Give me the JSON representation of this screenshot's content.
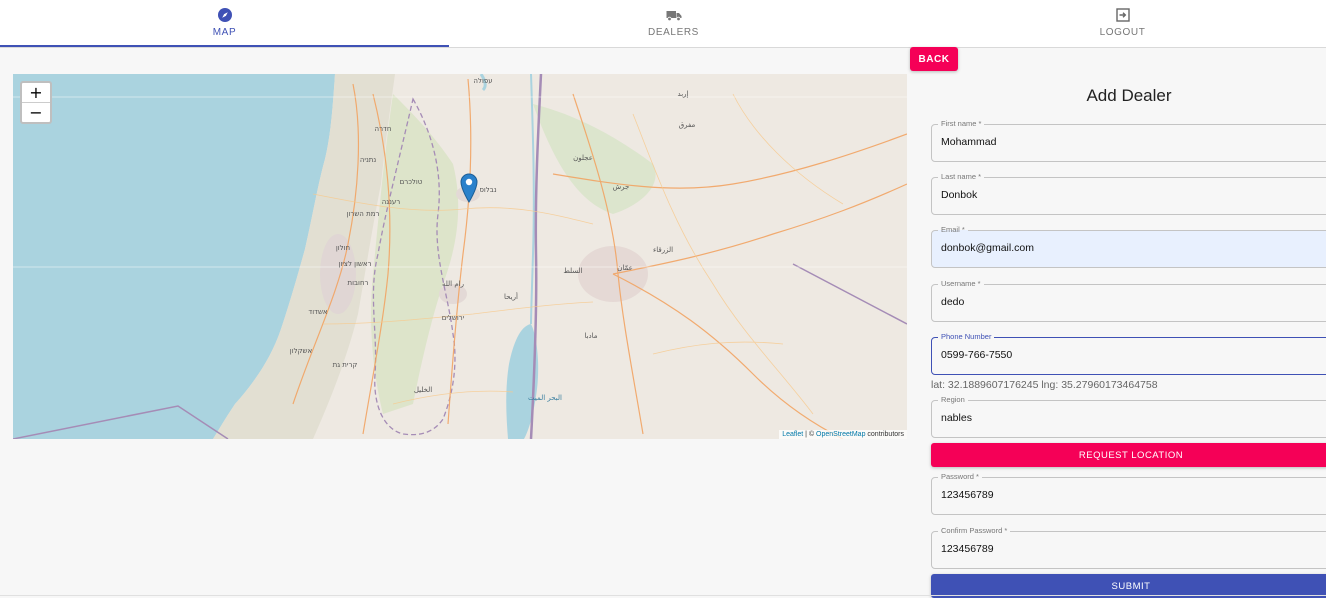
{
  "tabs": [
    {
      "label": "MAP",
      "icon": "compass-icon",
      "active": true
    },
    {
      "label": "DEALERS",
      "icon": "truck-icon",
      "active": false
    },
    {
      "label": "LOGOUT",
      "icon": "logout-icon",
      "active": false
    }
  ],
  "back_label": "BACK",
  "map": {
    "zoom_in": "+",
    "zoom_out": "−",
    "attribution": {
      "leaflet": "Leaflet",
      "sep": " | © ",
      "osm": "OpenStreetMap",
      "suffix": " contributors"
    },
    "place_labels": [
      "עפולה",
      "נתניה",
      "חדרה",
      "נבלוס",
      "טולכרם",
      "רמת השרון",
      "רעננה",
      "חולון",
      "ראשון לציון",
      "רחובות",
      "אשדוד",
      "אשקלון",
      "קרית גת",
      "ירושלים",
      "رام الله",
      "أريحا",
      "الخليل",
      "عمّان",
      "الزرقاء",
      "السلط",
      "جرش",
      "عجلون",
      "إربد",
      "مادبا",
      "مفرق",
      "البحر الميت"
    ]
  },
  "form": {
    "title": "Add Dealer",
    "fields": [
      {
        "label": "First name *",
        "value": "Mohammad"
      },
      {
        "label": "Last name *",
        "value": "Donbok"
      },
      {
        "label": "Email *",
        "value": "donbok@gmail.com"
      },
      {
        "label": "Username *",
        "value": "dedo"
      },
      {
        "label": "Phone Number",
        "value": "0599-766-7550"
      },
      {
        "label": "Region",
        "value": "nables"
      },
      {
        "label": "Password *",
        "value": "123456789"
      },
      {
        "label": "Confirm Password *",
        "value": "123456789"
      }
    ],
    "coords": "lat: 32.1889607176245 lng: 35.27960173464758",
    "request_location": "REQUEST LOCATION",
    "submit": "SUBMIT"
  },
  "colors": {
    "primary": "#3f51b5",
    "secondary": "#f50057",
    "sea": "#aad3df"
  }
}
